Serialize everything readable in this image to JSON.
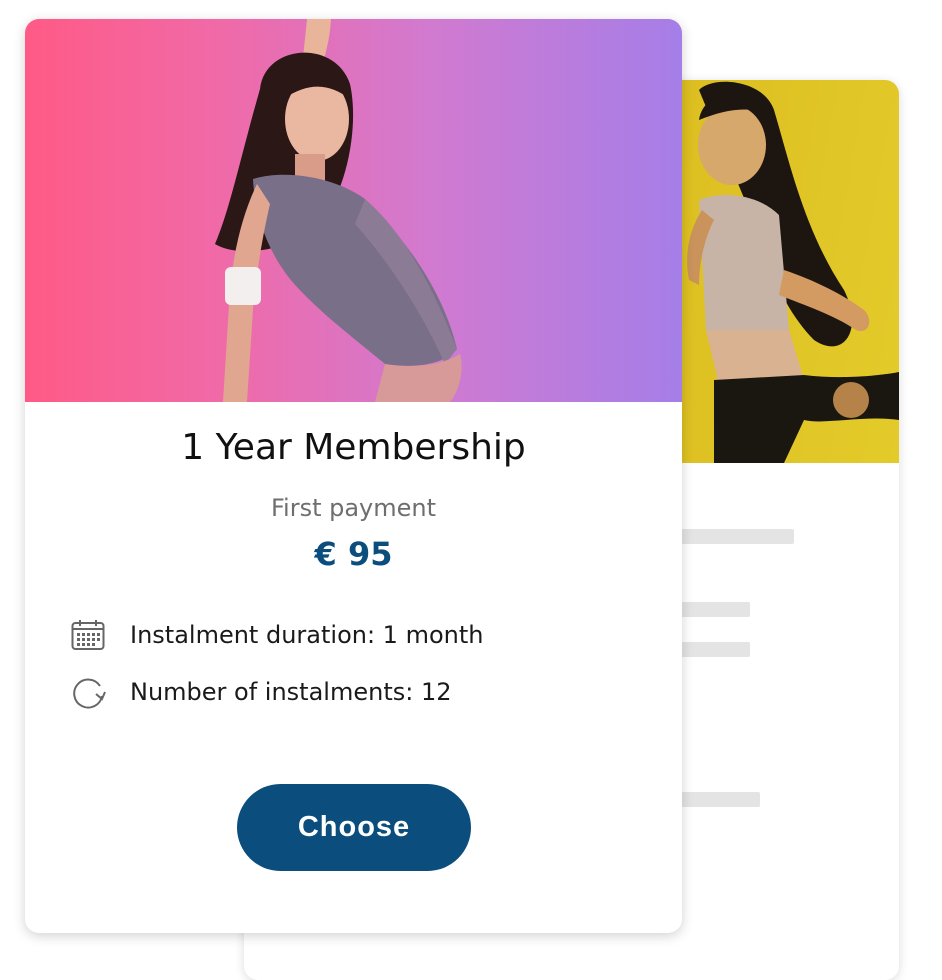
{
  "front_card": {
    "title": "1 Year Membership",
    "first_payment_label": "First payment",
    "price": "€ 95",
    "details": [
      {
        "icon": "calendar-icon",
        "text": "Instalment duration: 1 month"
      },
      {
        "icon": "refresh-icon",
        "text": "Number of instalments: 12"
      }
    ],
    "button_label": "Choose"
  },
  "colors": {
    "brand": "#0b4d7d",
    "hero_gradient_start": "#ff5a86",
    "hero_gradient_end": "#a57ee8",
    "back_hero": "#d9b81c"
  }
}
